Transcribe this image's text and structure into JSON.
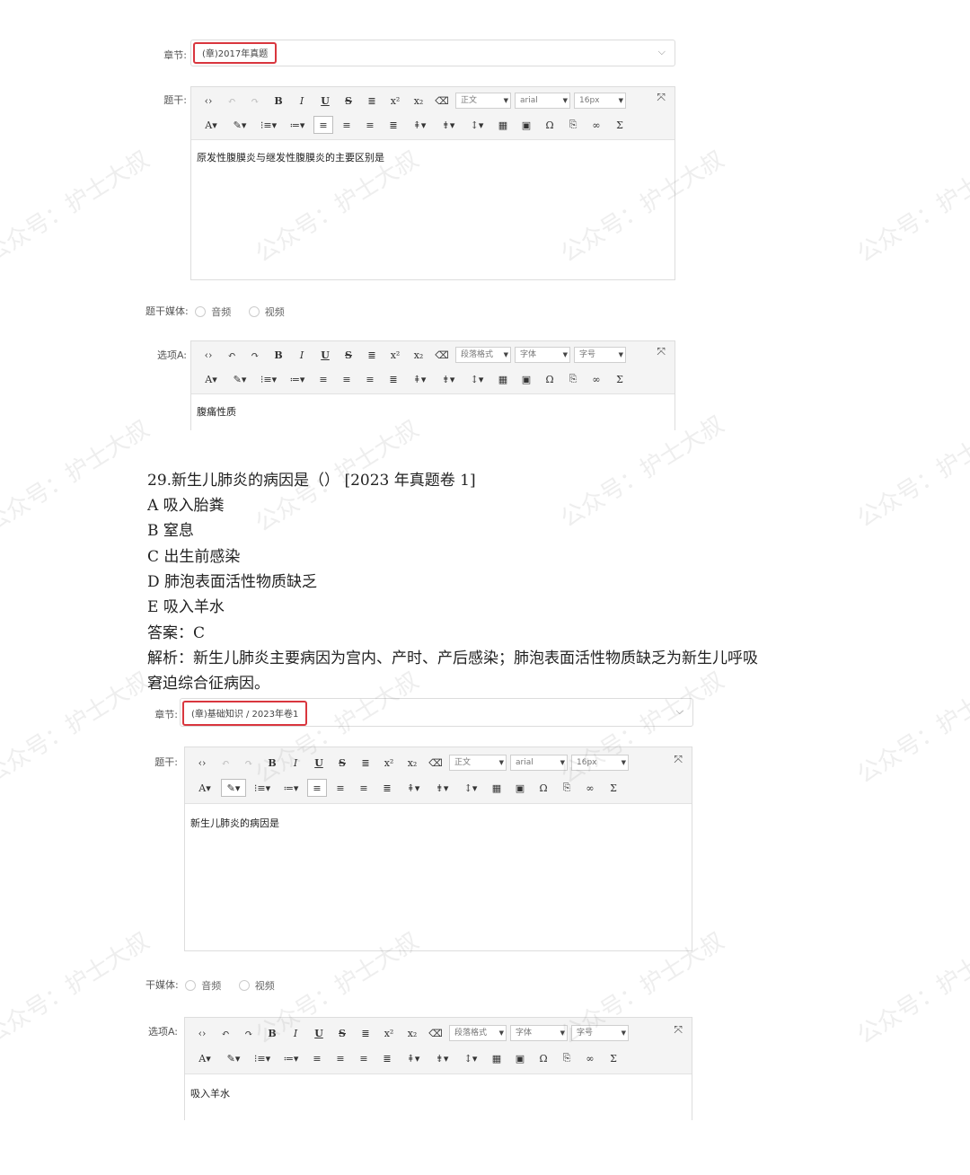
{
  "block1": {
    "chapter_label": "章节:",
    "chapter_value": "(章)2017年真题",
    "stem_label": "题干:",
    "toolbar": {
      "style": "正文",
      "font": "arial",
      "size": "16px"
    },
    "stem_text": "原发性腹膜炎与继发性腹膜炎的主要区别是",
    "media_label": "题干媒体:",
    "media_options": [
      "音频",
      "视频"
    ],
    "option_label": "选项A:",
    "option_toolbar": {
      "style": "段落格式",
      "font": "字体",
      "size": "字号"
    },
    "option_text": "腹痛性质"
  },
  "question": {
    "title": "29.新生儿肺炎的病因是（）   [2023 年真题卷 1]",
    "options": [
      "A 吸入胎粪",
      "B 窒息",
      "C 出生前感染",
      "D 肺泡表面活性物质缺乏",
      "E 吸入羊水"
    ],
    "answer": "答案：C",
    "analysis_1": "解析：新生儿肺炎主要病因为宫内、产时、产后感染；肺泡表面活性物质缺乏为新生儿呼吸",
    "analysis_2": "窘迫综合征病因。"
  },
  "block2": {
    "chapter_label": "章节:",
    "chapter_value": "(章)基础知识 / 2023年卷1",
    "stem_label": "题干:",
    "toolbar": {
      "style": "正文",
      "font": "arial",
      "size": "16px"
    },
    "stem_text": "新生儿肺炎的病因是",
    "media_label": "干媒体:",
    "media_options": [
      "音频",
      "视频"
    ],
    "option_label": "选项A:",
    "option_toolbar": {
      "style": "段落格式",
      "font": "字体",
      "size": "字号"
    },
    "option_text": "吸入羊水"
  },
  "watermark": "公众号：护士大叔"
}
